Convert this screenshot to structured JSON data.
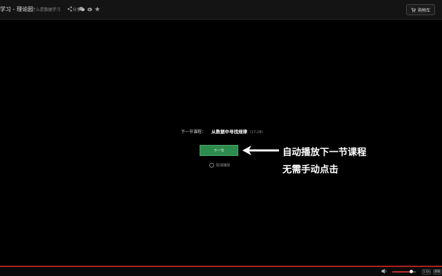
{
  "header": {
    "title": "学习 - 理论园",
    "subtitle": "3-4 什么是数据学习",
    "cart_label": "购物车",
    "tools": [
      {
        "name": "share-icon",
        "label": "分享"
      },
      {
        "name": "wechat-icon"
      },
      {
        "name": "weibo-icon"
      },
      {
        "name": "qzone-icon"
      }
    ]
  },
  "player": {
    "next_label": "下一节课程：",
    "next_title": "从数据中寻找规律",
    "next_duration": "(17:28)",
    "next_button": "下一节",
    "cancel_label": "取消播放"
  },
  "annotation": {
    "line1": "自动播放下一节课程",
    "line2": "无需手动点击"
  },
  "controls": {
    "volume": 0.8,
    "btn1": "1.0x",
    "btn2": "清晰",
    "accent": "#c0302d"
  }
}
